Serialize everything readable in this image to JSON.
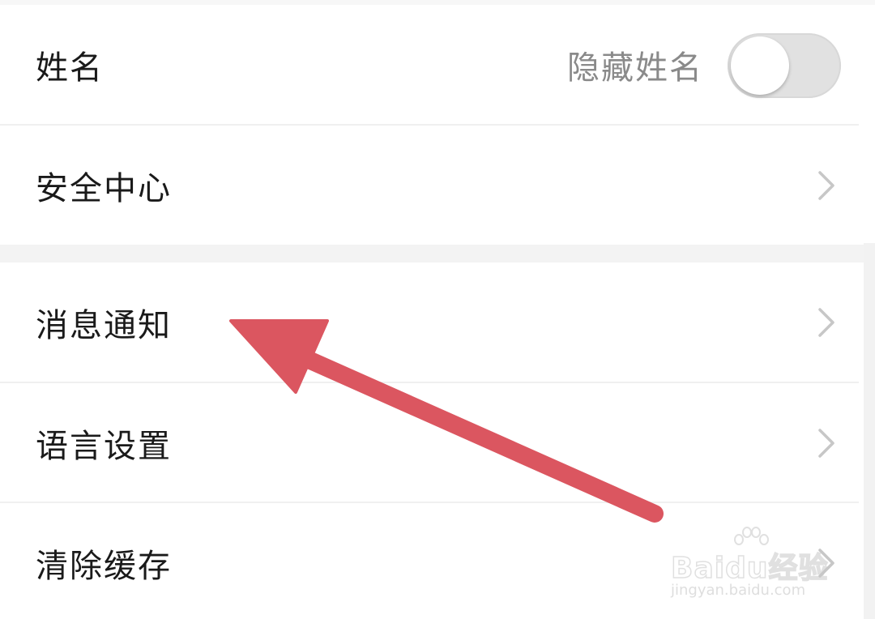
{
  "settings": {
    "rows": [
      {
        "label": "姓名",
        "hide_name_label": "隐藏姓名",
        "hide_name_on": false
      },
      {
        "label": "安全中心"
      },
      {
        "label": "消息通知"
      },
      {
        "label": "语言设置"
      },
      {
        "label": "清除缓存"
      }
    ]
  },
  "annotation": {
    "color": "#db5660",
    "shape": "arrow",
    "points_to": "消息通知"
  },
  "watermark": {
    "brand": "Baidu经验",
    "url": "jingyan.baidu.com"
  },
  "icons": [
    "chevron-right-icon",
    "toggle-switch",
    "baidu-paw-icon"
  ]
}
